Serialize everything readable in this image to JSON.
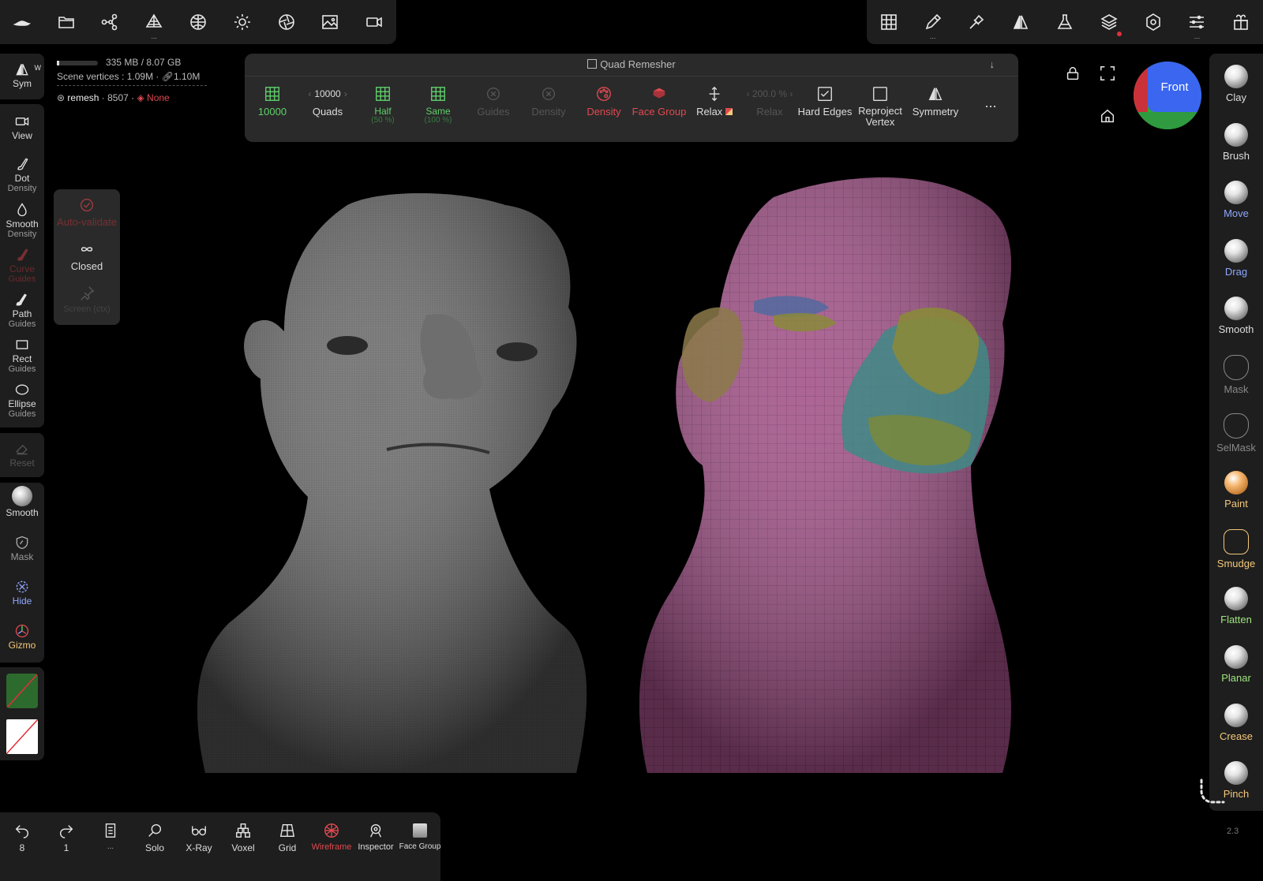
{
  "colors": {
    "accent_green": "#5fd16b",
    "accent_red": "#e0494f",
    "disabled": "#555555",
    "blue_label": "#8fa8ff",
    "green_label": "#9fe57d",
    "orange_label": "#f4c87a"
  },
  "stats": {
    "memory": "335 MB / 8.07 GB",
    "vertices_label": "Scene vertices :",
    "vertices": "1.09M",
    "linked_vertices": "1.10M",
    "mesh_name": "remesh",
    "mesh_count": "8507",
    "material": "None"
  },
  "topbar_left": {
    "icons": [
      "sculpt-app-icon",
      "folder-icon",
      "scene-graph-icon",
      "topology-icon",
      "material-icon",
      "light-icon",
      "post-process-icon",
      "background-icon",
      "camera-icon"
    ]
  },
  "topbar_right": {
    "icons": [
      "remesh-grid-icon",
      "brush-stroke-icon",
      "picker-icon",
      "symmetry-icon",
      "flask-icon",
      "layers-icon",
      "settings-icon",
      "sliders-icon",
      "gift-icon"
    ]
  },
  "leftbar": {
    "sym": {
      "label": "Sym",
      "badge": "W"
    },
    "view": {
      "label": "View"
    },
    "dot": {
      "label": "Dot",
      "sub": "Density"
    },
    "smooth_density": {
      "label": "Smooth",
      "sub": "Density"
    },
    "curve": {
      "label": "Curve",
      "sub": "Guides"
    },
    "path": {
      "label": "Path",
      "sub": "Guides"
    },
    "rect": {
      "label": "Rect",
      "sub": "Guides"
    },
    "ellipse": {
      "label": "Ellipse",
      "sub": "Guides"
    },
    "reset": {
      "label": "Reset"
    },
    "smooth": {
      "label": "Smooth"
    },
    "mask": {
      "label": "Mask"
    },
    "hide": {
      "label": "Hide"
    },
    "gizmo": {
      "label": "Gizmo"
    }
  },
  "autopanel": {
    "auto_validate": "Auto-validate",
    "closed": "Closed",
    "screen": "Screen (ctx)"
  },
  "remesher": {
    "title": "Quad Remesher",
    "count_value": "10000",
    "quads_value": "10000",
    "quads_label": "Quads",
    "half_label": "Half",
    "half_sub": "(50 %)",
    "same_label": "Same",
    "same_sub": "(100 %)",
    "guides_label": "Guides",
    "density_disabled_label": "Density",
    "density_label": "Density",
    "face_group_label": "Face Group",
    "relax_label": "Relax",
    "relax_value": "200.0 %",
    "relax_disabled_label": "Relax",
    "hard_edges_label": "Hard Edges",
    "reproject_label": "Reproject",
    "reproject_label2": "Vertex",
    "symmetry_label": "Symmetry",
    "more_label": "..."
  },
  "view_cube": {
    "label": "Front"
  },
  "rightbar": {
    "items": [
      {
        "label": "Clay",
        "color": "#dddddd"
      },
      {
        "label": "Brush",
        "color": "#dddddd"
      },
      {
        "label": "Move",
        "color": "#8fa8ff"
      },
      {
        "label": "Drag",
        "color": "#8fa8ff"
      },
      {
        "label": "Smooth",
        "color": "#dddddd"
      },
      {
        "label": "Mask",
        "color": "#888888"
      },
      {
        "label": "SelMask",
        "color": "#888888"
      },
      {
        "label": "Paint",
        "color": "#f4c87a"
      },
      {
        "label": "Smudge",
        "color": "#f4c87a"
      },
      {
        "label": "Flatten",
        "color": "#9fe57d"
      },
      {
        "label": "Planar",
        "color": "#9fe57d"
      },
      {
        "label": "Crease",
        "color": "#f4c87a"
      },
      {
        "label": "Pinch",
        "color": "#f4c87a"
      }
    ]
  },
  "bottombar": {
    "undo_count": "8",
    "redo_count": "1",
    "doc_label": "...",
    "solo": "Solo",
    "xray": "X-Ray",
    "voxel": "Voxel",
    "grid": "Grid",
    "wireframe": "Wireframe",
    "inspector": "Inspector",
    "face_group": "Face Group"
  },
  "version": "2.3"
}
